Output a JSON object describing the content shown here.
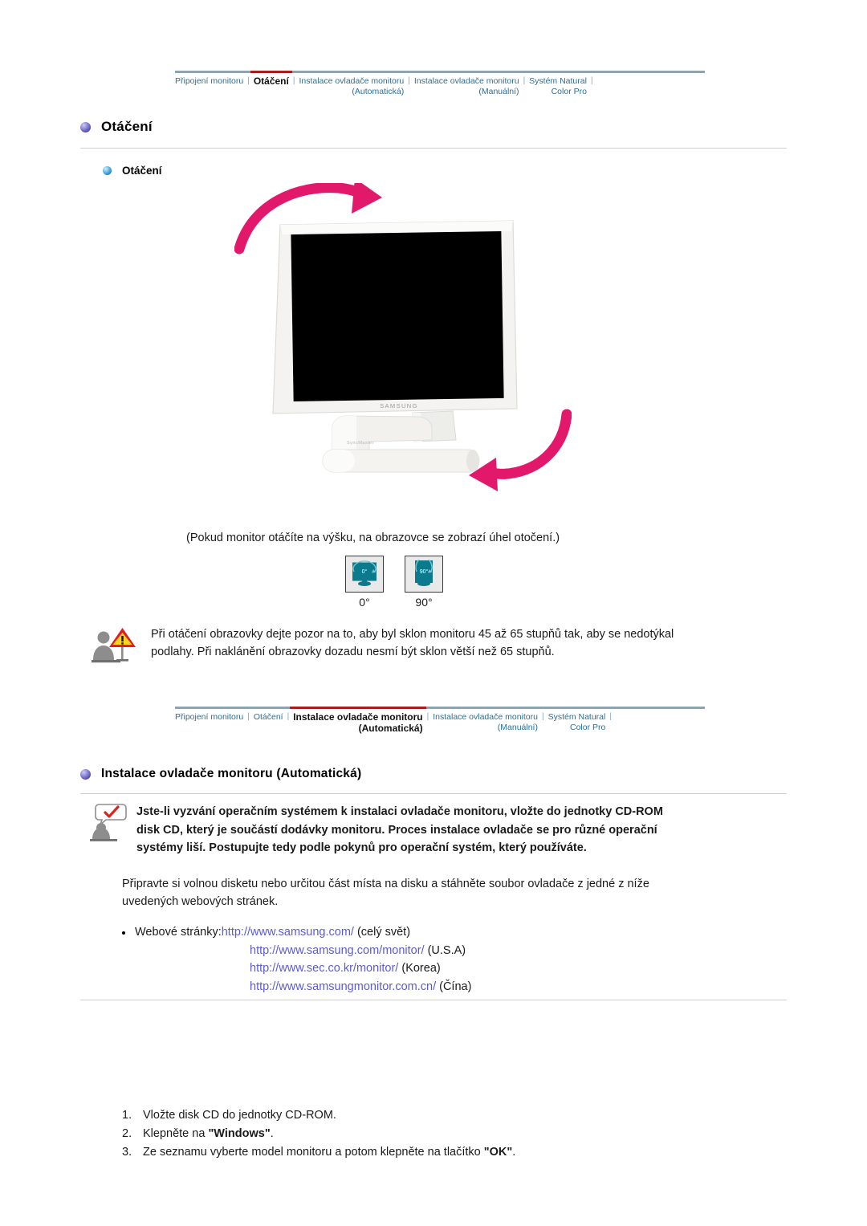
{
  "nav_top": {
    "active_index": 1,
    "items": [
      {
        "label": "Připojení monitoru",
        "lines": [
          "Připojení monitoru"
        ],
        "active": false
      },
      {
        "label": "Otáčení",
        "lines": [
          "Otáčení"
        ],
        "active": true
      },
      {
        "label": "Instalace ovladače monitoru (Automatická)",
        "lines": [
          "Instalace ovladače monitoru",
          "(Automatická)"
        ],
        "active": false
      },
      {
        "label": "Instalace ovladače monitoru (Manuální)",
        "lines": [
          "Instalace ovladače monitoru",
          "(Manuální)"
        ],
        "active": false
      },
      {
        "label": "Systém Natural Color Pro",
        "lines": [
          "Systém Natural",
          "Color Pro"
        ],
        "active": false
      }
    ],
    "separator": "|",
    "rule_color": "#8fa3ac",
    "active_rule_color": "#a81d1d",
    "link_color": "#2b6e96"
  },
  "nav_bottom": {
    "active_index": 2,
    "items": [
      {
        "label": "Připojení monitoru",
        "lines": [
          "Připojení monitoru"
        ],
        "active": false
      },
      {
        "label": "Otáčení",
        "lines": [
          "Otáčení"
        ],
        "active": false
      },
      {
        "label": "Instalace ovladače monitoru (Automatická)",
        "lines": [
          "Instalace ovladače monitoru",
          "(Automatická)"
        ],
        "active": true
      },
      {
        "label": "Instalace ovladače monitoru (Manuální)",
        "lines": [
          "Instalace ovladače monitoru",
          "(Manuální)"
        ],
        "active": false
      },
      {
        "label": "Systém Natural Color Pro",
        "lines": [
          "Systém Natural",
          "Color Pro"
        ],
        "active": false
      }
    ],
    "separator": "|"
  },
  "section1": {
    "heading": "Otáčení",
    "subheading": "Otáčení",
    "caption": "(Pokud monitor otáčíte na výšku, na obrazovce se zobrazí úhel otočení.)",
    "osd_icons": [
      {
        "angle_text": "0°",
        "label": "0°",
        "icon": "monitor-rotation-0-icon"
      },
      {
        "angle_text": "90°",
        "label": "90°",
        "icon": "monitor-rotation-90-icon"
      }
    ],
    "monitor_image": {
      "brand": "SAMSUNG",
      "icon": "rotating-monitor-illustration",
      "arrow_color": "#e2186a"
    },
    "warning": {
      "icon": "warning-person-icon",
      "text": "Při otáčení obrazovky dejte pozor na to, aby byl sklon monitoru 45 až 65 stupňů tak, aby se nedotýkal podlahy. Při naklánění obrazovky dozadu nesmí být sklon větší než 65 stupňů."
    }
  },
  "section2": {
    "heading": "Instalace ovladače monitoru (Automatická)",
    "note": {
      "icon": "note-person-check-icon",
      "text": "Jste-li vyzvání operačním systémem k instalaci ovladače monitoru, vložte do jednotky CD-ROM disk CD, který je součástí dodávky monitoru. Proces instalace ovladače se pro různé operační systémy liší. Postupujte tedy podle pokynů pro operační systém, který používáte."
    },
    "paragraph": "Připravte si volnou disketu nebo určitou část místa na disku a stáhněte soubor ovladače z jedné z níže uvedených webových stránek.",
    "websites_label": "Webové stránky:",
    "websites": [
      {
        "url": "http://www.samsung.com/",
        "region": "(celý svět)"
      },
      {
        "url": "http://www.samsung.com/monitor/",
        "region": "(U.S.A)"
      },
      {
        "url": "http://www.sec.co.kr/monitor/",
        "region": "(Korea)"
      },
      {
        "url": "http://www.samsungmonitor.com.cn/",
        "region": "(Čína)"
      }
    ],
    "link_color": "#5b5bd6",
    "steps": [
      {
        "num": "1.",
        "pre": "Vložte disk CD do jednotky CD-ROM.",
        "bold": "",
        "post": ""
      },
      {
        "num": "2.",
        "pre": "Klepněte na ",
        "bold": "\"Windows\"",
        "post": "."
      },
      {
        "num": "3.",
        "pre": "Ze seznamu vyberte model monitoru a potom klepněte na tlačítko ",
        "bold": "\"OK\"",
        "post": "."
      }
    ]
  }
}
